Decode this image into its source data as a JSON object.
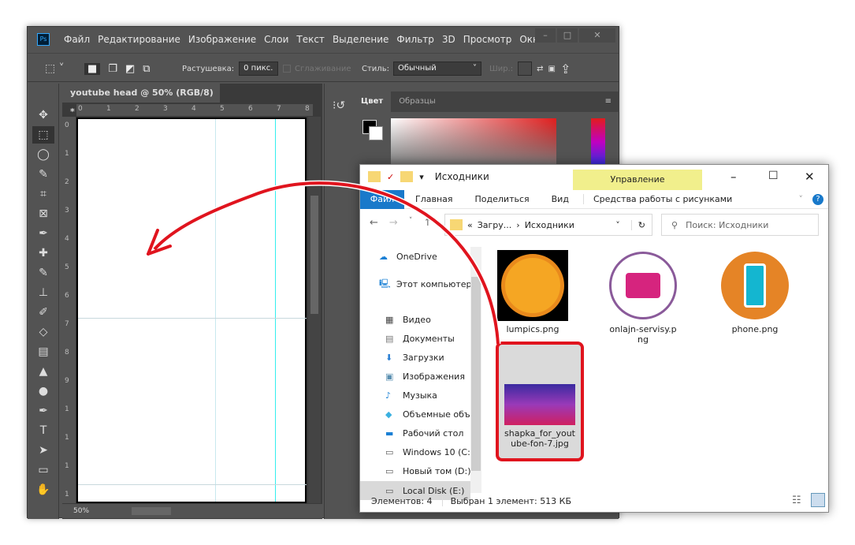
{
  "photoshop": {
    "logo": "Ps",
    "menu": [
      "Файл",
      "Редактирование",
      "Изображение",
      "Слои",
      "Текст",
      "Выделение",
      "Фильтр",
      "3D",
      "Просмотр",
      "Окно"
    ],
    "options": {
      "feather_label": "Растушевка:",
      "feather_value": "0 пикс.",
      "antialias_label": "Сглаживание",
      "style_label": "Стиль:",
      "style_value": "Обычный",
      "width_label": "Шир.:"
    },
    "document_tab": "youtube head @ 50% (RGB/8) *",
    "h_ruler": [
      "0",
      "1",
      "2",
      "3",
      "4",
      "5",
      "6",
      "7",
      "8"
    ],
    "v_ruler": [
      "0",
      "1",
      "2",
      "3",
      "4",
      "5",
      "6",
      "7",
      "8",
      "9",
      "1",
      "1",
      "1",
      "1"
    ],
    "zoom": "50%",
    "panel_tabs": [
      "Цвет",
      "Образцы"
    ],
    "tools": [
      "move",
      "marquee",
      "lasso",
      "quick-select",
      "crop",
      "frame",
      "eyedropper",
      "healing",
      "brush",
      "stamp",
      "history-brush",
      "eraser",
      "gradient",
      "blur",
      "dodge",
      "pen",
      "type",
      "path-select",
      "rectangle",
      "hand"
    ]
  },
  "explorer": {
    "title": "Исходники",
    "manage_tab": "Управление",
    "ribbon_tabs": [
      "Файл",
      "Главная",
      "Поделиться",
      "Вид",
      "Средства работы с рисунками"
    ],
    "breadcrumb": [
      "«",
      "Загру...",
      "›",
      "Исходники"
    ],
    "search_placeholder": "Поиск: Исходники",
    "nav": [
      {
        "label": "OneDrive",
        "icon": "cloud-icon"
      },
      {
        "label": "Этот компьютер",
        "icon": "computer-icon"
      },
      {
        "label": "Видео",
        "icon": "video-icon"
      },
      {
        "label": "Документы",
        "icon": "document-icon"
      },
      {
        "label": "Загрузки",
        "icon": "download-icon"
      },
      {
        "label": "Изображения",
        "icon": "image-icon"
      },
      {
        "label": "Музыка",
        "icon": "music-icon"
      },
      {
        "label": "Объемные объ",
        "icon": "cube-icon"
      },
      {
        "label": "Рабочий стол",
        "icon": "desktop-icon"
      },
      {
        "label": "Windows 10 (C:)",
        "icon": "drive-icon"
      },
      {
        "label": "Новый том (D:)",
        "icon": "drive-icon"
      },
      {
        "label": "Local Disk (E:)",
        "icon": "drive-icon"
      }
    ],
    "files": [
      {
        "name": "lumpics.png"
      },
      {
        "name": "onlajn-servisy.png"
      },
      {
        "name": "phone.png"
      },
      {
        "name": "shapka_for_youtube-fon-7.jpg",
        "selected": true
      }
    ],
    "status_count": "Элементов: 4",
    "status_selected": "Выбран 1 элемент: 513 КБ",
    "manage_color": "#f1ef8c",
    "highlight_color": "#e0141e"
  }
}
